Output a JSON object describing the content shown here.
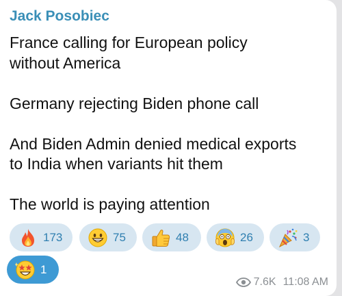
{
  "message": {
    "sender": "Jack Posobiec",
    "lines": [
      "France calling for European policy",
      "without America",
      "",
      "Germany rejecting Biden phone call",
      "",
      "And Biden Admin denied medical exports",
      "to India when variants hit them",
      "",
      "The world is paying attention"
    ],
    "views": "7.6K",
    "time": "11:08 AM"
  },
  "reactions": [
    {
      "emoji": "fire-icon",
      "count": "173",
      "selected": false
    },
    {
      "emoji": "grinning-face-icon",
      "count": "75",
      "selected": false
    },
    {
      "emoji": "thumbs-up-icon",
      "count": "48",
      "selected": false
    },
    {
      "emoji": "screaming-face-icon",
      "count": "26",
      "selected": false
    },
    {
      "emoji": "party-popper-icon",
      "count": "3",
      "selected": false
    },
    {
      "emoji": "star-struck-icon",
      "count": "1",
      "selected": true
    }
  ],
  "colors": {
    "sender": "#3a8fb7",
    "chip_bg": "#d7e6f1",
    "chip_selected_bg": "#3e9ad4",
    "count_text": "#2f7fb0",
    "meta_text": "#8b8f93"
  }
}
